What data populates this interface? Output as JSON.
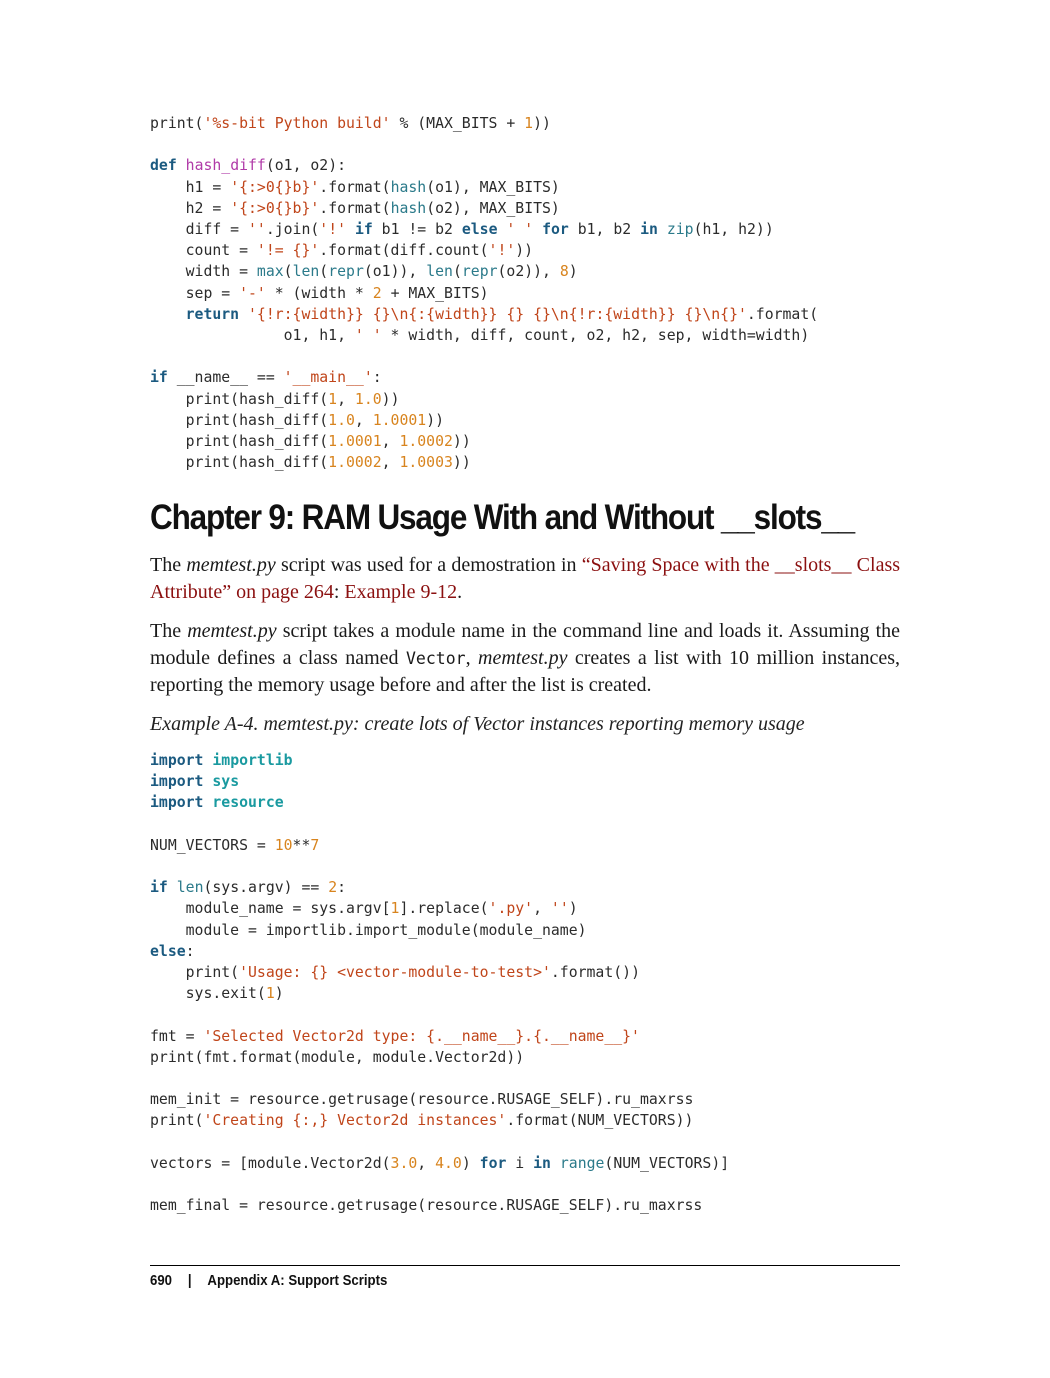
{
  "code_top": {
    "lines": [
      [
        [
          "print(",
          ""
        ],
        [
          "'%s-bit Python build'",
          "s"
        ],
        [
          " % (MAX_BITS + ",
          ""
        ],
        [
          "1",
          "n"
        ],
        [
          "))",
          ""
        ]
      ],
      [],
      [
        [
          "def",
          "k"
        ],
        [
          " ",
          ""
        ],
        [
          "hash_diff",
          "fn"
        ],
        [
          "(o1, o2):",
          ""
        ]
      ],
      [
        [
          "    h1 = ",
          ""
        ],
        [
          "'{:>0{}b}'",
          "s"
        ],
        [
          ".format(",
          ""
        ],
        [
          "hash",
          "b"
        ],
        [
          "(o1), MAX_BITS)",
          ""
        ]
      ],
      [
        [
          "    h2 = ",
          ""
        ],
        [
          "'{:>0{}b}'",
          "s"
        ],
        [
          ".format(",
          ""
        ],
        [
          "hash",
          "b"
        ],
        [
          "(o2), MAX_BITS)",
          ""
        ]
      ],
      [
        [
          "    diff = ",
          ""
        ],
        [
          "''",
          "s"
        ],
        [
          ".join(",
          ""
        ],
        [
          "'!'",
          "s"
        ],
        [
          " ",
          ""
        ],
        [
          "if",
          "k"
        ],
        [
          " b1 != b2 ",
          ""
        ],
        [
          "else",
          "k"
        ],
        [
          " ",
          ""
        ],
        [
          "' '",
          "s"
        ],
        [
          " ",
          ""
        ],
        [
          "for",
          "k"
        ],
        [
          " b1, b2 ",
          ""
        ],
        [
          "in",
          "k"
        ],
        [
          " ",
          ""
        ],
        [
          "zip",
          "b"
        ],
        [
          "(h1, h2))",
          ""
        ]
      ],
      [
        [
          "    count = ",
          ""
        ],
        [
          "'!= {}'",
          "s"
        ],
        [
          ".format(diff.count(",
          ""
        ],
        [
          "'!'",
          "s"
        ],
        [
          "))",
          ""
        ]
      ],
      [
        [
          "    width = ",
          ""
        ],
        [
          "max",
          "b"
        ],
        [
          "(",
          ""
        ],
        [
          "len",
          "b"
        ],
        [
          "(",
          ""
        ],
        [
          "repr",
          "b"
        ],
        [
          "(o1)), ",
          ""
        ],
        [
          "len",
          "b"
        ],
        [
          "(",
          ""
        ],
        [
          "repr",
          "b"
        ],
        [
          "(o2)), ",
          ""
        ],
        [
          "8",
          "n"
        ],
        [
          ")",
          ""
        ]
      ],
      [
        [
          "    sep = ",
          ""
        ],
        [
          "'-'",
          "s"
        ],
        [
          " * (width * ",
          ""
        ],
        [
          "2",
          "n"
        ],
        [
          " + MAX_BITS)",
          ""
        ]
      ],
      [
        [
          "    ",
          ""
        ],
        [
          "return",
          "k"
        ],
        [
          " ",
          ""
        ],
        [
          "'{!r:{width}} {}\\n{:{width}} {} {}\\n{!r:{width}} {}\\n{}'",
          "s"
        ],
        [
          ".format(",
          ""
        ]
      ],
      [
        [
          "               o1, h1, ",
          ""
        ],
        [
          "' '",
          "s"
        ],
        [
          " * width, diff, count, o2, h2, sep, width=width)",
          ""
        ]
      ],
      [],
      [
        [
          "if",
          "k"
        ],
        [
          " __name__ == ",
          ""
        ],
        [
          "'__main__'",
          "s"
        ],
        [
          ":",
          ""
        ]
      ],
      [
        [
          "    print(hash_diff(",
          ""
        ],
        [
          "1",
          "n"
        ],
        [
          ", ",
          ""
        ],
        [
          "1.0",
          "n"
        ],
        [
          "))",
          ""
        ]
      ],
      [
        [
          "    print(hash_diff(",
          ""
        ],
        [
          "1.0",
          "n"
        ],
        [
          ", ",
          ""
        ],
        [
          "1.0001",
          "n"
        ],
        [
          "))",
          ""
        ]
      ],
      [
        [
          "    print(hash_diff(",
          ""
        ],
        [
          "1.0001",
          "n"
        ],
        [
          ", ",
          ""
        ],
        [
          "1.0002",
          "n"
        ],
        [
          "))",
          ""
        ]
      ],
      [
        [
          "    print(hash_diff(",
          ""
        ],
        [
          "1.0002",
          "n"
        ],
        [
          ", ",
          ""
        ],
        [
          "1.0003",
          "n"
        ],
        [
          "))",
          ""
        ]
      ]
    ]
  },
  "heading": "Chapter 9: RAM Usage With and Without __slots__",
  "para1": {
    "before": "The ",
    "file": "memtest.py",
    "mid": " script was used for a demostration in ",
    "ref": "“Saving Space with the __slots__ Class Attribute” on page 264",
    "colon": ": ",
    "example_ref": "Example 9-12",
    "end": "."
  },
  "para2": {
    "file1": "memtest.py",
    "text1": " script takes a module name in the command line and loads it. Assuming the module defines a class named ",
    "code": "Vector",
    "comma": ", ",
    "file2": "memtest.py",
    "text2": " creates a list with 10 million instances, reporting the memory usage before and after the list is created.",
    "lead": "The "
  },
  "caption": "Example A-4. memtest.py: create lots of Vector instances reporting memory usage",
  "code_bottom": {
    "lines": [
      [
        [
          "import",
          "k"
        ],
        [
          " ",
          ""
        ],
        [
          "importlib",
          "mod"
        ]
      ],
      [
        [
          "import",
          "k"
        ],
        [
          " ",
          ""
        ],
        [
          "sys",
          "mod"
        ]
      ],
      [
        [
          "import",
          "k"
        ],
        [
          " ",
          ""
        ],
        [
          "resource",
          "mod"
        ]
      ],
      [],
      [
        [
          "NUM_VECTORS = ",
          ""
        ],
        [
          "10",
          "n"
        ],
        [
          "**",
          ""
        ],
        [
          "7",
          "n"
        ]
      ],
      [],
      [
        [
          "if",
          "k"
        ],
        [
          " ",
          ""
        ],
        [
          "len",
          "b"
        ],
        [
          "(sys.argv) == ",
          ""
        ],
        [
          "2",
          "n"
        ],
        [
          ":",
          ""
        ]
      ],
      [
        [
          "    module_name = sys.argv[",
          ""
        ],
        [
          "1",
          "n"
        ],
        [
          "].replace(",
          ""
        ],
        [
          "'.py'",
          "s"
        ],
        [
          ", ",
          ""
        ],
        [
          "''",
          "s"
        ],
        [
          ")",
          ""
        ]
      ],
      [
        [
          "    module = importlib.import_module(module_name)",
          ""
        ]
      ],
      [
        [
          "else",
          "k"
        ],
        [
          ":",
          ""
        ]
      ],
      [
        [
          "    print(",
          ""
        ],
        [
          "'Usage: {} <vector-module-to-test>'",
          "s"
        ],
        [
          ".format())",
          ""
        ]
      ],
      [
        [
          "    sys.exit(",
          ""
        ],
        [
          "1",
          "n"
        ],
        [
          ")",
          ""
        ]
      ],
      [],
      [
        [
          "fmt = ",
          ""
        ],
        [
          "'Selected Vector2d type: {.__name__}.{.__name__}'",
          "s"
        ]
      ],
      [
        [
          "print(fmt.format(module, module.Vector2d))",
          ""
        ]
      ],
      [],
      [
        [
          "mem_init = resource.getrusage(resource.RUSAGE_SELF).ru_maxrss",
          ""
        ]
      ],
      [
        [
          "print(",
          ""
        ],
        [
          "'Creating {:,} Vector2d instances'",
          "s"
        ],
        [
          ".format(NUM_VECTORS))",
          ""
        ]
      ],
      [],
      [
        [
          "vectors = [module.Vector2d(",
          ""
        ],
        [
          "3.0",
          "n"
        ],
        [
          ", ",
          ""
        ],
        [
          "4.0",
          "n"
        ],
        [
          ") ",
          ""
        ],
        [
          "for",
          "k"
        ],
        [
          " i ",
          ""
        ],
        [
          "in",
          "k"
        ],
        [
          " ",
          ""
        ],
        [
          "range",
          "b"
        ],
        [
          "(NUM_VECTORS)]",
          ""
        ]
      ],
      [],
      [
        [
          "mem_final = resource.getrusage(resource.RUSAGE_SELF).ru_maxrss",
          ""
        ]
      ]
    ]
  },
  "footer": {
    "page_number": "690",
    "separator": "|",
    "section": "Appendix A: Support Scripts"
  }
}
